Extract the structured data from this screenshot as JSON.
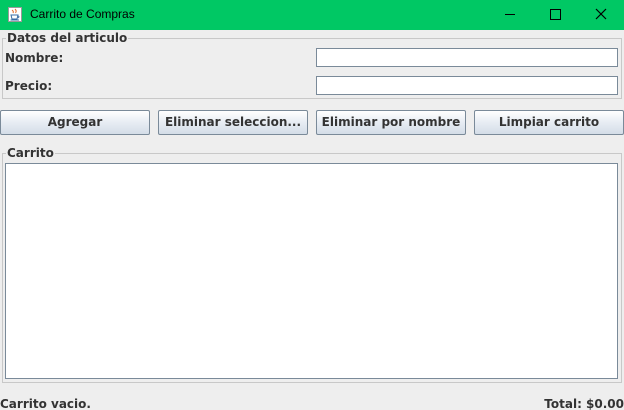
{
  "window": {
    "title": "Carrito de Compras",
    "titlebar_color": "#00c864",
    "icon": "java-cup-icon"
  },
  "window_controls": {
    "minimize_icon": "minimize-icon",
    "maximize_icon": "maximize-icon",
    "close_icon": "close-icon"
  },
  "item_group": {
    "legend": "Datos del articulo",
    "name_label": "Nombre:",
    "name_value": "",
    "price_label": "Precio:",
    "price_value": ""
  },
  "actions": {
    "add_label": "Agregar",
    "remove_selected_label": "Eliminar seleccion...",
    "remove_by_name_label": "Eliminar por nombre",
    "clear_cart_label": "Limpiar carrito"
  },
  "cart_group": {
    "legend": "Carrito",
    "items": []
  },
  "status": {
    "message": "Carrito vacio.",
    "total": "Total: $0.00"
  }
}
